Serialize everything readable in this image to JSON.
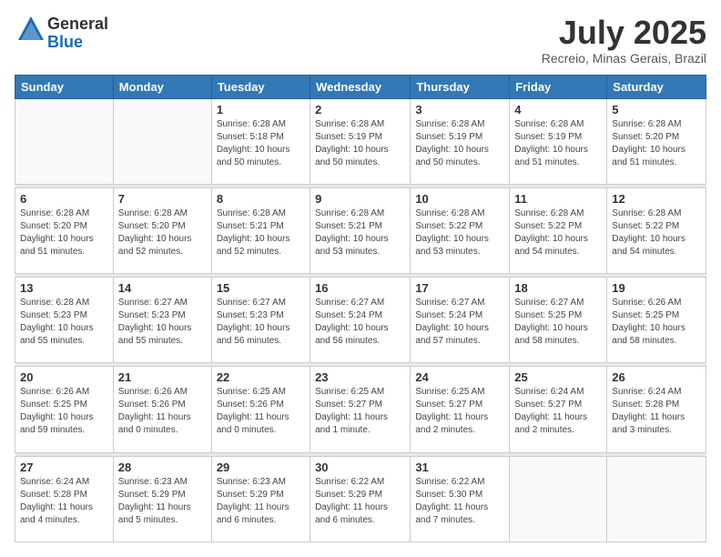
{
  "logo": {
    "general": "General",
    "blue": "Blue"
  },
  "title": "July 2025",
  "location": "Recreio, Minas Gerais, Brazil",
  "weekdays": [
    "Sunday",
    "Monday",
    "Tuesday",
    "Wednesday",
    "Thursday",
    "Friday",
    "Saturday"
  ],
  "weeks": [
    [
      {
        "day": "",
        "info": ""
      },
      {
        "day": "",
        "info": ""
      },
      {
        "day": "1",
        "info": "Sunrise: 6:28 AM\nSunset: 5:18 PM\nDaylight: 10 hours\nand 50 minutes."
      },
      {
        "day": "2",
        "info": "Sunrise: 6:28 AM\nSunset: 5:19 PM\nDaylight: 10 hours\nand 50 minutes."
      },
      {
        "day": "3",
        "info": "Sunrise: 6:28 AM\nSunset: 5:19 PM\nDaylight: 10 hours\nand 50 minutes."
      },
      {
        "day": "4",
        "info": "Sunrise: 6:28 AM\nSunset: 5:19 PM\nDaylight: 10 hours\nand 51 minutes."
      },
      {
        "day": "5",
        "info": "Sunrise: 6:28 AM\nSunset: 5:20 PM\nDaylight: 10 hours\nand 51 minutes."
      }
    ],
    [
      {
        "day": "6",
        "info": "Sunrise: 6:28 AM\nSunset: 5:20 PM\nDaylight: 10 hours\nand 51 minutes."
      },
      {
        "day": "7",
        "info": "Sunrise: 6:28 AM\nSunset: 5:20 PM\nDaylight: 10 hours\nand 52 minutes."
      },
      {
        "day": "8",
        "info": "Sunrise: 6:28 AM\nSunset: 5:21 PM\nDaylight: 10 hours\nand 52 minutes."
      },
      {
        "day": "9",
        "info": "Sunrise: 6:28 AM\nSunset: 5:21 PM\nDaylight: 10 hours\nand 53 minutes."
      },
      {
        "day": "10",
        "info": "Sunrise: 6:28 AM\nSunset: 5:22 PM\nDaylight: 10 hours\nand 53 minutes."
      },
      {
        "day": "11",
        "info": "Sunrise: 6:28 AM\nSunset: 5:22 PM\nDaylight: 10 hours\nand 54 minutes."
      },
      {
        "day": "12",
        "info": "Sunrise: 6:28 AM\nSunset: 5:22 PM\nDaylight: 10 hours\nand 54 minutes."
      }
    ],
    [
      {
        "day": "13",
        "info": "Sunrise: 6:28 AM\nSunset: 5:23 PM\nDaylight: 10 hours\nand 55 minutes."
      },
      {
        "day": "14",
        "info": "Sunrise: 6:27 AM\nSunset: 5:23 PM\nDaylight: 10 hours\nand 55 minutes."
      },
      {
        "day": "15",
        "info": "Sunrise: 6:27 AM\nSunset: 5:23 PM\nDaylight: 10 hours\nand 56 minutes."
      },
      {
        "day": "16",
        "info": "Sunrise: 6:27 AM\nSunset: 5:24 PM\nDaylight: 10 hours\nand 56 minutes."
      },
      {
        "day": "17",
        "info": "Sunrise: 6:27 AM\nSunset: 5:24 PM\nDaylight: 10 hours\nand 57 minutes."
      },
      {
        "day": "18",
        "info": "Sunrise: 6:27 AM\nSunset: 5:25 PM\nDaylight: 10 hours\nand 58 minutes."
      },
      {
        "day": "19",
        "info": "Sunrise: 6:26 AM\nSunset: 5:25 PM\nDaylight: 10 hours\nand 58 minutes."
      }
    ],
    [
      {
        "day": "20",
        "info": "Sunrise: 6:26 AM\nSunset: 5:25 PM\nDaylight: 10 hours\nand 59 minutes."
      },
      {
        "day": "21",
        "info": "Sunrise: 6:26 AM\nSunset: 5:26 PM\nDaylight: 11 hours\nand 0 minutes."
      },
      {
        "day": "22",
        "info": "Sunrise: 6:25 AM\nSunset: 5:26 PM\nDaylight: 11 hours\nand 0 minutes."
      },
      {
        "day": "23",
        "info": "Sunrise: 6:25 AM\nSunset: 5:27 PM\nDaylight: 11 hours\nand 1 minute."
      },
      {
        "day": "24",
        "info": "Sunrise: 6:25 AM\nSunset: 5:27 PM\nDaylight: 11 hours\nand 2 minutes."
      },
      {
        "day": "25",
        "info": "Sunrise: 6:24 AM\nSunset: 5:27 PM\nDaylight: 11 hours\nand 2 minutes."
      },
      {
        "day": "26",
        "info": "Sunrise: 6:24 AM\nSunset: 5:28 PM\nDaylight: 11 hours\nand 3 minutes."
      }
    ],
    [
      {
        "day": "27",
        "info": "Sunrise: 6:24 AM\nSunset: 5:28 PM\nDaylight: 11 hours\nand 4 minutes."
      },
      {
        "day": "28",
        "info": "Sunrise: 6:23 AM\nSunset: 5:29 PM\nDaylight: 11 hours\nand 5 minutes."
      },
      {
        "day": "29",
        "info": "Sunrise: 6:23 AM\nSunset: 5:29 PM\nDaylight: 11 hours\nand 6 minutes."
      },
      {
        "day": "30",
        "info": "Sunrise: 6:22 AM\nSunset: 5:29 PM\nDaylight: 11 hours\nand 6 minutes."
      },
      {
        "day": "31",
        "info": "Sunrise: 6:22 AM\nSunset: 5:30 PM\nDaylight: 11 hours\nand 7 minutes."
      },
      {
        "day": "",
        "info": ""
      },
      {
        "day": "",
        "info": ""
      }
    ]
  ]
}
